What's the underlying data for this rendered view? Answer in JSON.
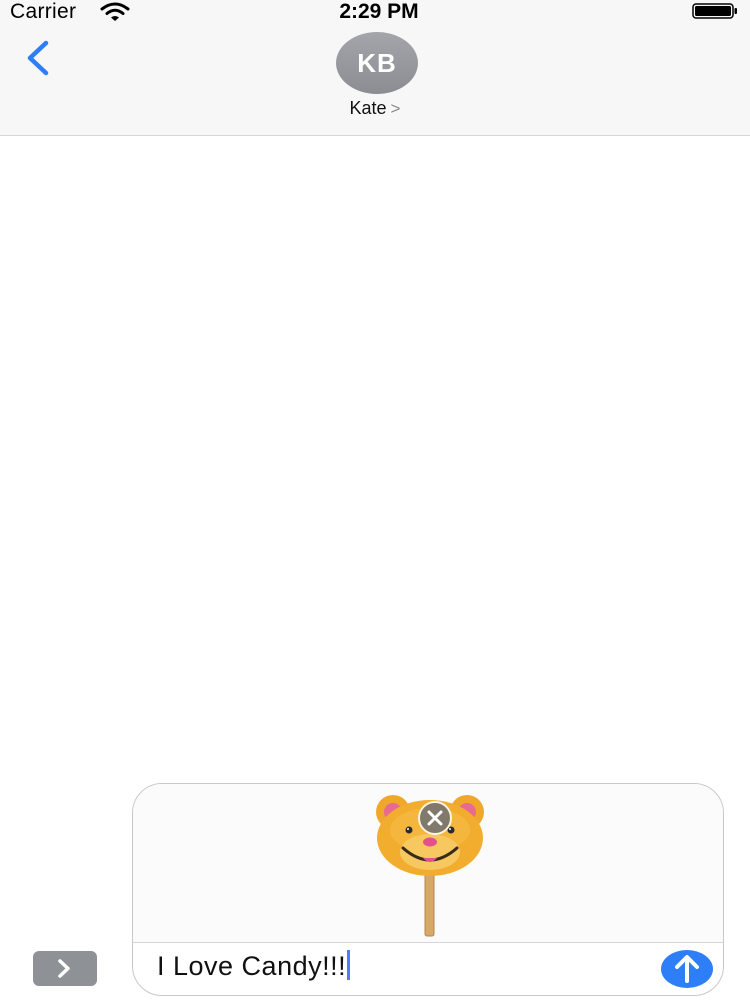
{
  "status_bar": {
    "carrier": "Carrier",
    "time": "2:29 PM",
    "icons": [
      "wifi-icon",
      "battery-icon"
    ]
  },
  "nav": {
    "back_icon": "chevron-left-icon",
    "avatar_initials": "KB",
    "contact_name": "Kate",
    "contact_chevron": ">"
  },
  "compose": {
    "attachment": {
      "type": "sticker",
      "icon": "bear-lollipop-sticker",
      "remove_icon": "close-icon"
    },
    "message_text": "I Love Candy!!!",
    "send_icon": "arrow-up-icon"
  },
  "apps_button_icon": "chevron-right-icon",
  "colors": {
    "accent": "#2d7ef7",
    "avatar_bg": "#9a9ca2",
    "header_bg": "#f7f7f8",
    "sticker_face": "#f0a82c"
  }
}
